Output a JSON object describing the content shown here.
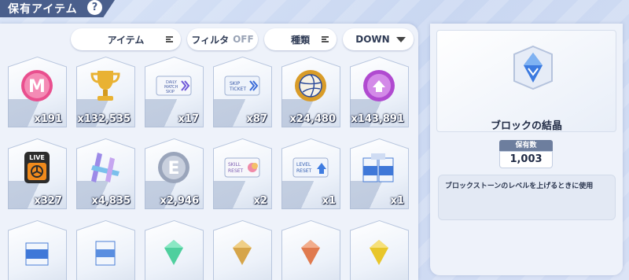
{
  "header": {
    "title": "保有アイテム",
    "help": "?"
  },
  "filters": {
    "category": "アイテム",
    "filter_label": "フィルタ",
    "filter_state": "OFF",
    "sort_key": "種類",
    "sort_order": "DOWN"
  },
  "items": [
    {
      "name": "m-coin-icon",
      "qty": "x191"
    },
    {
      "name": "trophy-icon",
      "qty": "x132,535"
    },
    {
      "name": "daily-match-skip-ticket-icon",
      "qty": "x17",
      "label": "DAILY MATCH SKIP"
    },
    {
      "name": "skip-ticket-icon",
      "qty": "x87",
      "label": "SKIP TICKET"
    },
    {
      "name": "volleyball-coin-icon",
      "qty": "x24,480"
    },
    {
      "name": "purple-coin-icon",
      "qty": "x143,891"
    },
    {
      "name": "live-ticket-icon",
      "qty": "x327",
      "label": "LIVE"
    },
    {
      "name": "crystal-sticks-icon",
      "qty": "x4,835"
    },
    {
      "name": "e-coin-icon",
      "qty": "x2,946"
    },
    {
      "name": "skill-reset-ticket-icon",
      "qty": "x2",
      "label": "SKILL RESET"
    },
    {
      "name": "level-reset-ticket-icon",
      "qty": "x1",
      "label": "LEVEL RESET"
    },
    {
      "name": "milk-cartons-icon",
      "qty": "x1"
    },
    {
      "name": "milk-carton-blue-icon",
      "qty": ""
    },
    {
      "name": "milk-carton-icon",
      "qty": ""
    },
    {
      "name": "green-gem-icon",
      "qty": ""
    },
    {
      "name": "gold-gem-icon",
      "qty": ""
    },
    {
      "name": "orange-gem-icon",
      "qty": ""
    },
    {
      "name": "yellow-gem-icon",
      "qty": ""
    }
  ],
  "detail": {
    "name": "ブロックの結晶",
    "count_label": "保有数",
    "count_value": "1,003",
    "description": "ブロックストーンのレベルを上げるときに使用"
  }
}
